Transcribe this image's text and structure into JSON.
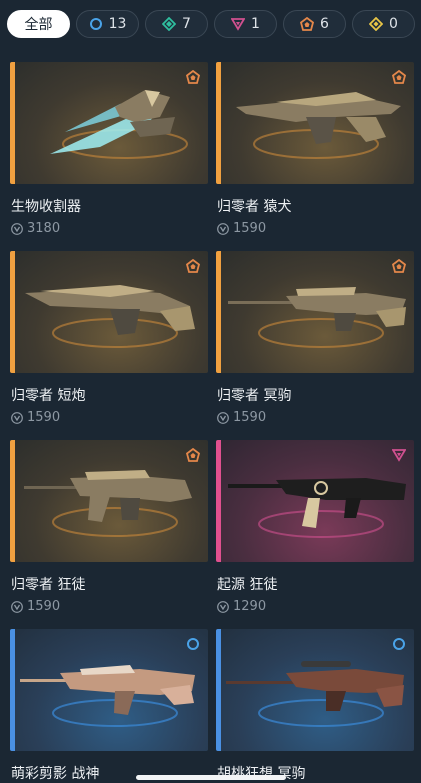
{
  "filters": {
    "all": "全部",
    "tiers": [
      {
        "icon": "select-tier-icon",
        "count": "13",
        "color": "#4aa3e8"
      },
      {
        "icon": "deluxe-tier-icon",
        "count": "7",
        "color": "#2fbf9f"
      },
      {
        "icon": "premium-tier-icon",
        "count": "1",
        "color": "#d0508f"
      },
      {
        "icon": "exclusive-tier-icon",
        "count": "6",
        "color": "#e4874a"
      },
      {
        "icon": "ultra-tier-icon",
        "count": "0",
        "color": "#e8c547"
      }
    ]
  },
  "skins": [
    {
      "name": "生物收割器",
      "price": "3180",
      "tier": "exclusive",
      "accent": "#f0a040"
    },
    {
      "name": "归零者 猿犬",
      "price": "1590",
      "tier": "exclusive",
      "accent": "#f0a040"
    },
    {
      "name": "归零者 短炮",
      "price": "1590",
      "tier": "exclusive",
      "accent": "#f0a040"
    },
    {
      "name": "归零者 冥驹",
      "price": "1590",
      "tier": "exclusive",
      "accent": "#f0a040"
    },
    {
      "name": "归零者 狂徒",
      "price": "1590",
      "tier": "exclusive",
      "accent": "#f0a040"
    },
    {
      "name": "起源 狂徒",
      "price": "1290",
      "tier": "premium",
      "accent": "#e0508f"
    },
    {
      "name": "萌彩剪影 战神",
      "price": "",
      "tier": "select",
      "accent": "#4a90e2"
    },
    {
      "name": "胡桃狂想 冥驹",
      "price": "",
      "tier": "select",
      "accent": "#4a90e2"
    }
  ]
}
